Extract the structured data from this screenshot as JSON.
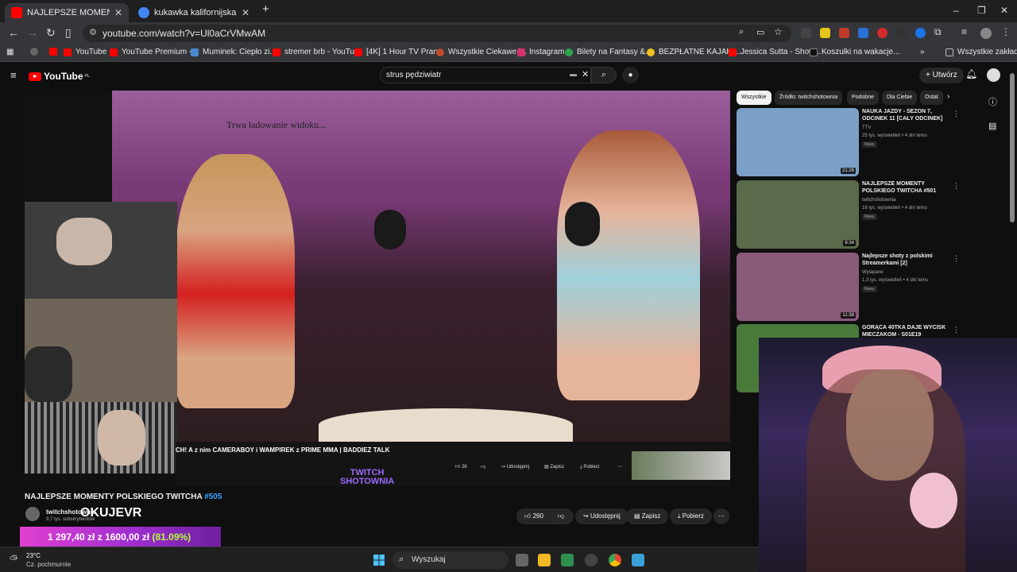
{
  "browser": {
    "tabs": [
      {
        "title": "NAJLEPSZE MOMENTY POLSKIEGO TWITCHA",
        "favicon_color": "#ff0000"
      },
      {
        "title": "kukawka kalifornijska - Szukaj w Google",
        "favicon_color": "#4285f4"
      }
    ],
    "new_tab": "+",
    "url": "youtube.com/watch?v=Ul0aCrVMwAM",
    "bookmarks": [
      "YouTube",
      "YouTube Premium -...",
      "Muminek: Ciepło zi...",
      "stremer brb - YouTu...",
      "[4K] 1 Hour TV Pran...",
      "Wszystkie Ciekawe i...",
      "Instagram",
      "Bilety na Fantasy &...",
      "BEZPŁATNE KAJAKI...",
      "Jessica Sutta - Show...",
      "Koszulki na wakacje..."
    ],
    "all_bookmarks": "Wszystkie zakładki"
  },
  "youtube": {
    "logo": "YouTube",
    "logo_region": "PL",
    "search_query": "strus pędziwiatr",
    "create_label": "Utwórz",
    "player": {
      "loading_text": "Trwa ładowanie widoku...",
      "inner_title": "CH! A z nim CAMERABOY i WAMPIREK z PRIME MMA | BADDIEZ TALK",
      "inner_likes": "28",
      "inner_share": "Udostępnij",
      "inner_save": "Zapisz",
      "inner_download": "Pobierz",
      "twitch_logo_line1": "TWITCH",
      "twitch_logo_line2": "SHOTOWNIA"
    },
    "video": {
      "title": "NAJLEPSZE MOMENTY POLSKIEGO TWITCHA",
      "episode": "#505",
      "channel": "twitchshotownia",
      "subscribers": "9,7 tys. subskrybentów",
      "likes": "260",
      "share": "Udostępnij",
      "save": "Zapisz",
      "download": "Pobierz"
    },
    "chips": [
      "Wszystkie",
      "Źródło: twitchshotownia",
      "Podobne",
      "Dla Ciebie",
      "Ostat"
    ],
    "recommendations": [
      {
        "title": "NAUKA JAZDY - SEZON 7, ODCINEK 11 [CAŁY ODCINEK]",
        "channel": "TTV",
        "meta": "25 tys. wyświetleń • 4 dni temu",
        "badge": "Nowy",
        "duration": "21:26",
        "color": "#7aa0c8"
      },
      {
        "title": "NAJLEPSZE MOMENTY POLSKIEGO TWITCHA #501",
        "channel": "twitchshotownia",
        "meta": "16 tys. wyświetleń • 4 dni temu",
        "badge": "Nowy",
        "duration": "8:34",
        "color": "#5a6a4a"
      },
      {
        "title": "Najlepsze shoty z polskimi Streamerkami [2]",
        "channel": "Wylapane",
        "meta": "1,3 tys. wyświetleń • 4 dni temu",
        "badge": "Nowy",
        "duration": "11:38",
        "color": "#8a5a7a"
      },
      {
        "title": "GORĄCA 40TKA DAJE WYCISK MIECZAKOM - S01E19",
        "channel": "",
        "meta": "",
        "badge": "",
        "duration": "",
        "color": "#4a7a3a"
      }
    ]
  },
  "stream_overlay": {
    "streamer_name": "OKUJEVR",
    "donation_current": "1 297,40 zł",
    "donation_sep": "z",
    "donation_goal": "1600,00 zł",
    "donation_pct": "(81.09%)"
  },
  "taskbar": {
    "temperature": "23°C",
    "weather": "Cz. pochmurnie",
    "search_label": "Wyszukaj"
  }
}
